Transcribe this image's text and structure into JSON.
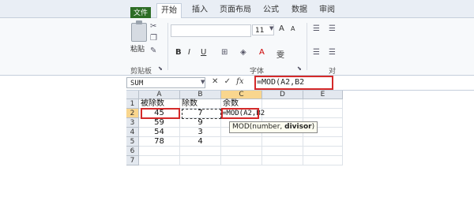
{
  "ribbon": {
    "tabs": [
      "文件",
      "开始",
      "插入",
      "页面布局",
      "公式",
      "数据",
      "审阅"
    ],
    "active_tab": "开始",
    "groups": {
      "clipboard": "剪贴板",
      "font": "字体",
      "align_partial": "对"
    },
    "paste_label": "粘贴",
    "font_size": "11",
    "grow_font": "A",
    "shrink_font": "A",
    "bold": "B",
    "italic": "I",
    "underline": "U",
    "font_color": "A",
    "phonetic": "雯"
  },
  "formula_bar": {
    "name_box": "SUM",
    "cancel": "✕",
    "enter": "✓",
    "fx": "fx",
    "formula": "=MOD(A2,B2"
  },
  "sheet": {
    "columns": [
      "A",
      "B",
      "C",
      "D",
      "E"
    ],
    "rows": [
      "1",
      "2",
      "3",
      "4",
      "5",
      "6",
      "7"
    ],
    "header": [
      "被除数",
      "除数",
      "余数"
    ],
    "data": [
      [
        "45",
        "7"
      ],
      [
        "59",
        "9"
      ],
      [
        "54",
        "3"
      ],
      [
        "78",
        "4"
      ]
    ],
    "edit_cell": "=MOD(A2,B2",
    "tooltip_fn": "MOD(number, ",
    "tooltip_arg": "divisor",
    "tooltip_end": ")"
  },
  "colors": {
    "highlight": "#d42a2a",
    "selected_header": "#f9d68e",
    "file_tab": "#2d6d25"
  }
}
